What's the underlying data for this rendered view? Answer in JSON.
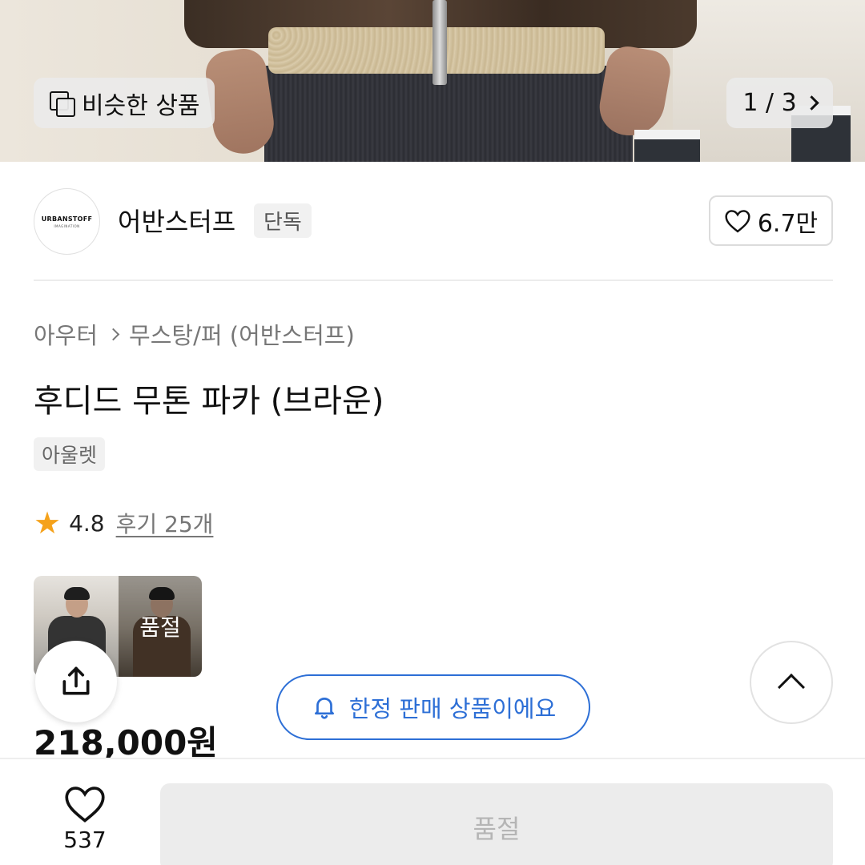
{
  "hero": {
    "similar_label": "비슷한 상품",
    "pager": "1 / 3"
  },
  "brand": {
    "logo_line1": "URBANSTOFF",
    "logo_line2": "IMAGINATION",
    "name": "어반스터프",
    "exclusive_badge": "단독",
    "like_count": "6.7만"
  },
  "product": {
    "breadcrumb": [
      "아우터",
      "무스탕/퍼 (어반스터프)"
    ],
    "title": "후디드 무톤 파카 (브라운)",
    "tag": "아울렛",
    "rating": "4.8",
    "reviews": "후기 25개",
    "thumbnail_soldout_label": "품절",
    "price": "218,000원"
  },
  "notice": {
    "limited_label": "한정 판매 상품이에요"
  },
  "bottom": {
    "wish_count": "537",
    "soldout_button": "품절"
  },
  "colors": {
    "accent_blue": "#2d6fd6",
    "star": "#f5a21b"
  }
}
